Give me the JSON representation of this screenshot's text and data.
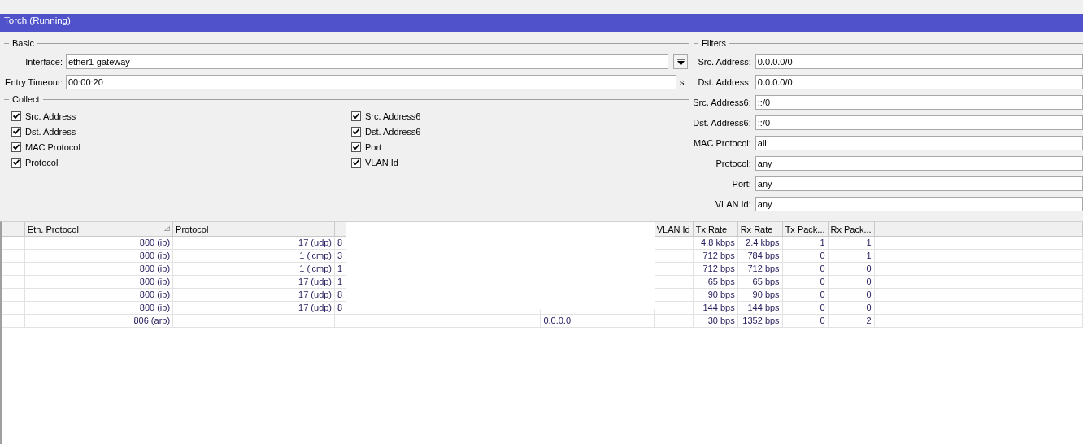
{
  "window": {
    "title": "Torch (Running)"
  },
  "basic": {
    "legend": "Basic",
    "interface": {
      "label": "Interface:",
      "value": "ether1-gateway"
    },
    "entry_timeout": {
      "label": "Entry Timeout:",
      "value": "00:00:20",
      "unit": "s"
    }
  },
  "collect": {
    "legend": "Collect",
    "items": [
      {
        "label": "Src. Address",
        "checked": true
      },
      {
        "label": "Dst. Address",
        "checked": true
      },
      {
        "label": "MAC Protocol",
        "checked": true
      },
      {
        "label": "Protocol",
        "checked": true
      },
      {
        "label": "Src. Address6",
        "checked": true
      },
      {
        "label": "Dst. Address6",
        "checked": true
      },
      {
        "label": "Port",
        "checked": true
      },
      {
        "label": "VLAN Id",
        "checked": true
      }
    ]
  },
  "filters": {
    "legend": "Filters",
    "fields": [
      {
        "label": "Src. Address:",
        "value": "0.0.0.0/0"
      },
      {
        "label": "Dst. Address:",
        "value": "0.0.0.0/0"
      },
      {
        "label": "Src. Address6:",
        "value": "::/0"
      },
      {
        "label": "Dst. Address6:",
        "value": "::/0"
      },
      {
        "label": "MAC Protocol:",
        "value": "all"
      },
      {
        "label": "Protocol:",
        "value": "any"
      },
      {
        "label": "Port:",
        "value": "any"
      },
      {
        "label": "VLAN Id:",
        "value": "any"
      }
    ]
  },
  "table": {
    "columns": [
      {
        "kind": "blank"
      },
      {
        "kind": "label",
        "label": "Eth. Protocol",
        "sorted": true
      },
      {
        "kind": "label",
        "label": "Protocol",
        "sorted": false
      },
      {
        "kind": "blank"
      },
      {
        "kind": "blank"
      },
      {
        "kind": "label",
        "label": "VLAN Id",
        "sorted": false
      },
      {
        "kind": "label",
        "label": "Tx Rate",
        "sorted": false
      },
      {
        "kind": "label",
        "label": "Rx Rate",
        "sorted": false
      },
      {
        "kind": "label",
        "label": "Tx Pack...",
        "sorted": false
      },
      {
        "kind": "label",
        "label": "Rx Pack...",
        "sorted": false
      }
    ],
    "rows": [
      {
        "cells": [
          "",
          "800 (ip)",
          "17 (udp)",
          "8",
          "",
          "",
          "4.8 kbps",
          "2.4 kbps",
          "1",
          "1"
        ]
      },
      {
        "cells": [
          "",
          "800 (ip)",
          "1 (icmp)",
          "3",
          "",
          "",
          "712 bps",
          "784 bps",
          "0",
          "1"
        ]
      },
      {
        "cells": [
          "",
          "800 (ip)",
          "1 (icmp)",
          "1",
          "",
          "",
          "712 bps",
          "712 bps",
          "0",
          "0"
        ]
      },
      {
        "cells": [
          "",
          "800 (ip)",
          "17 (udp)",
          "1",
          "",
          "",
          "65 bps",
          "65 bps",
          "0",
          "0"
        ]
      },
      {
        "cells": [
          "",
          "800 (ip)",
          "17 (udp)",
          "8",
          "",
          "",
          "90 bps",
          "90 bps",
          "0",
          "0"
        ]
      },
      {
        "cells": [
          "",
          "800 (ip)",
          "17 (udp)",
          "8",
          "",
          "",
          "144 bps",
          "144 bps",
          "0",
          "0"
        ]
      },
      {
        "cells": [
          "",
          "806 (arp)",
          "",
          "",
          "0.0.0.0",
          "",
          "30 bps",
          "1352 bps",
          "0",
          "2"
        ]
      }
    ]
  }
}
